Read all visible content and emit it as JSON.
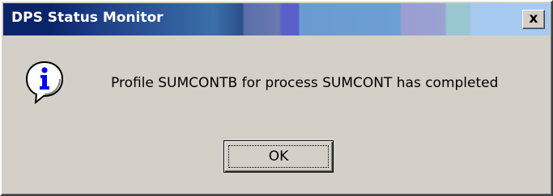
{
  "window": {
    "title": "DPS Status Monitor",
    "close_glyph": "×",
    "close_label": "x"
  },
  "dialog": {
    "icon": "information-icon",
    "message": "Profile SUMCONTB for process SUMCONT has completed",
    "ok_label": "OK"
  },
  "colors": {
    "face": "#d4d0c8",
    "title_start": "#0a246a",
    "title_end": "#a6caf0",
    "title_text": "#ffffff",
    "info_blue": "#0000ff"
  }
}
